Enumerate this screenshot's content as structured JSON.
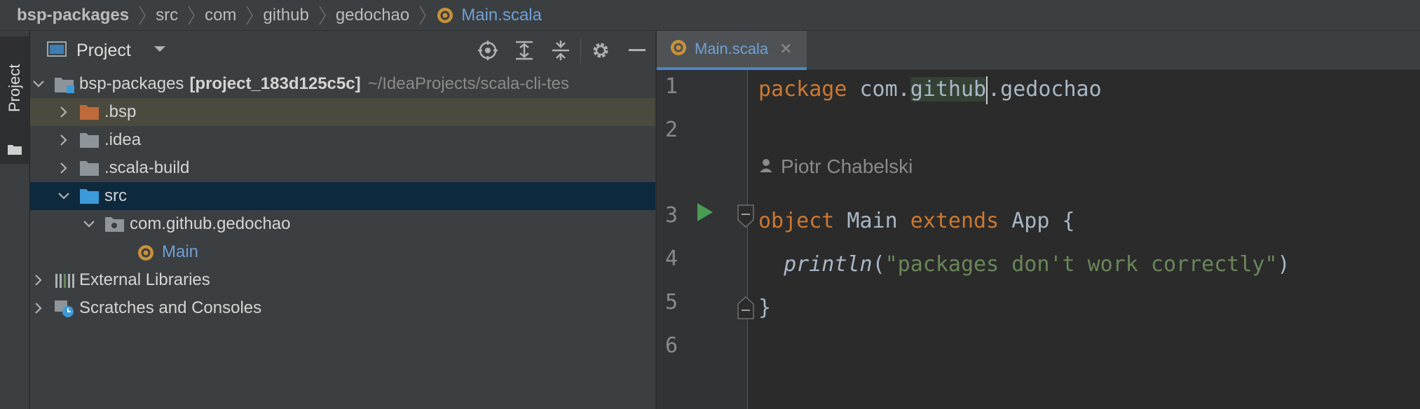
{
  "breadcrumb": {
    "items": [
      "bsp-packages",
      "src",
      "com",
      "github",
      "gedochao"
    ],
    "file": "Main.scala"
  },
  "stripe": {
    "label": "Project"
  },
  "project_panel": {
    "title": "Project",
    "tree": [
      {
        "label": "bsp-packages",
        "bold_suffix": "[project_183d125c5c]",
        "path": "~/IdeaProjects/scala-cli-tes"
      },
      {
        "label": ".bsp"
      },
      {
        "label": ".idea"
      },
      {
        "label": ".scala-build"
      },
      {
        "label": "src"
      },
      {
        "label": "com.github.gedochao"
      },
      {
        "label": "Main"
      },
      {
        "label": "External Libraries"
      },
      {
        "label": "Scratches and Consoles"
      }
    ]
  },
  "editor": {
    "tab_label": "Main.scala",
    "line_numbers": [
      "1",
      "2",
      "3",
      "4",
      "5",
      "6"
    ],
    "author": "Piotr Chabelski",
    "code": {
      "l1_kw": "package",
      "l1_a": " com.",
      "l1_b": "github",
      "l1_c": ".gedochao",
      "l3_kw1": "object",
      "l3_a": " Main ",
      "l3_kw2": "extends",
      "l3_b": " App {",
      "l4_indent": "  ",
      "l4_fn": "println",
      "l4_open": "(",
      "l4_str": "\"packages don't work correctly\"",
      "l4_close": ")",
      "l5": "}"
    }
  },
  "colors": {
    "keyword": "#cc7832",
    "string": "#6a8759",
    "link": "#6fa1d6",
    "selected_row": "#0d293e"
  }
}
